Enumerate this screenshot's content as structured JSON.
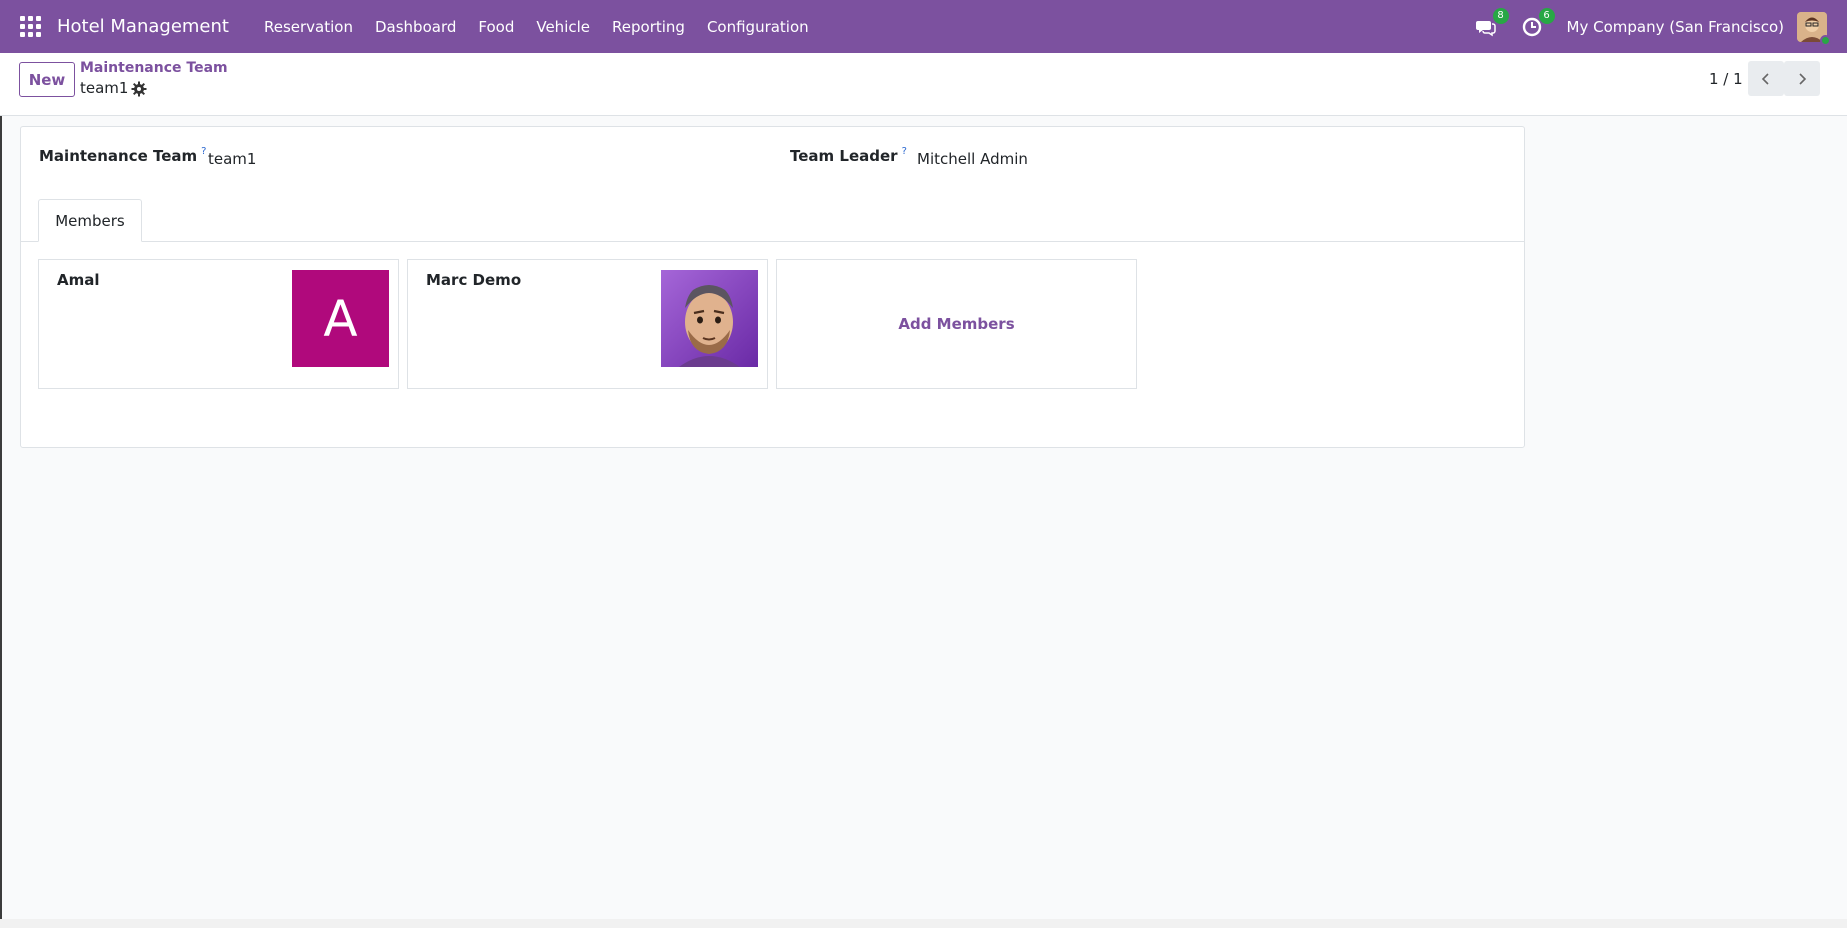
{
  "topbar": {
    "app_name": "Hotel Management",
    "menu": [
      "Reservation",
      "Dashboard",
      "Food",
      "Vehicle",
      "Reporting",
      "Configuration"
    ],
    "messages_count": "8",
    "activities_count": "6",
    "company": "My Company (San Francisco)",
    "accent_color": "#7c519f"
  },
  "control_panel": {
    "new_label": "New",
    "breadcrumb": "Maintenance Team",
    "record_name": "team1",
    "pager": "1 / 1"
  },
  "form": {
    "team_label": "Maintenance Team",
    "team_help": "?",
    "team_value": "team1",
    "leader_label": "Team Leader",
    "leader_help": "?",
    "leader_value": "Mitchell Admin",
    "tab_members": "Members",
    "members": [
      {
        "name": "Amal",
        "avatar_letter": "A",
        "avatar_color": "#b0097c"
      },
      {
        "name": "Marc Demo",
        "avatar_icon": "person-photo-icon"
      }
    ],
    "add_members_label": "Add Members"
  }
}
